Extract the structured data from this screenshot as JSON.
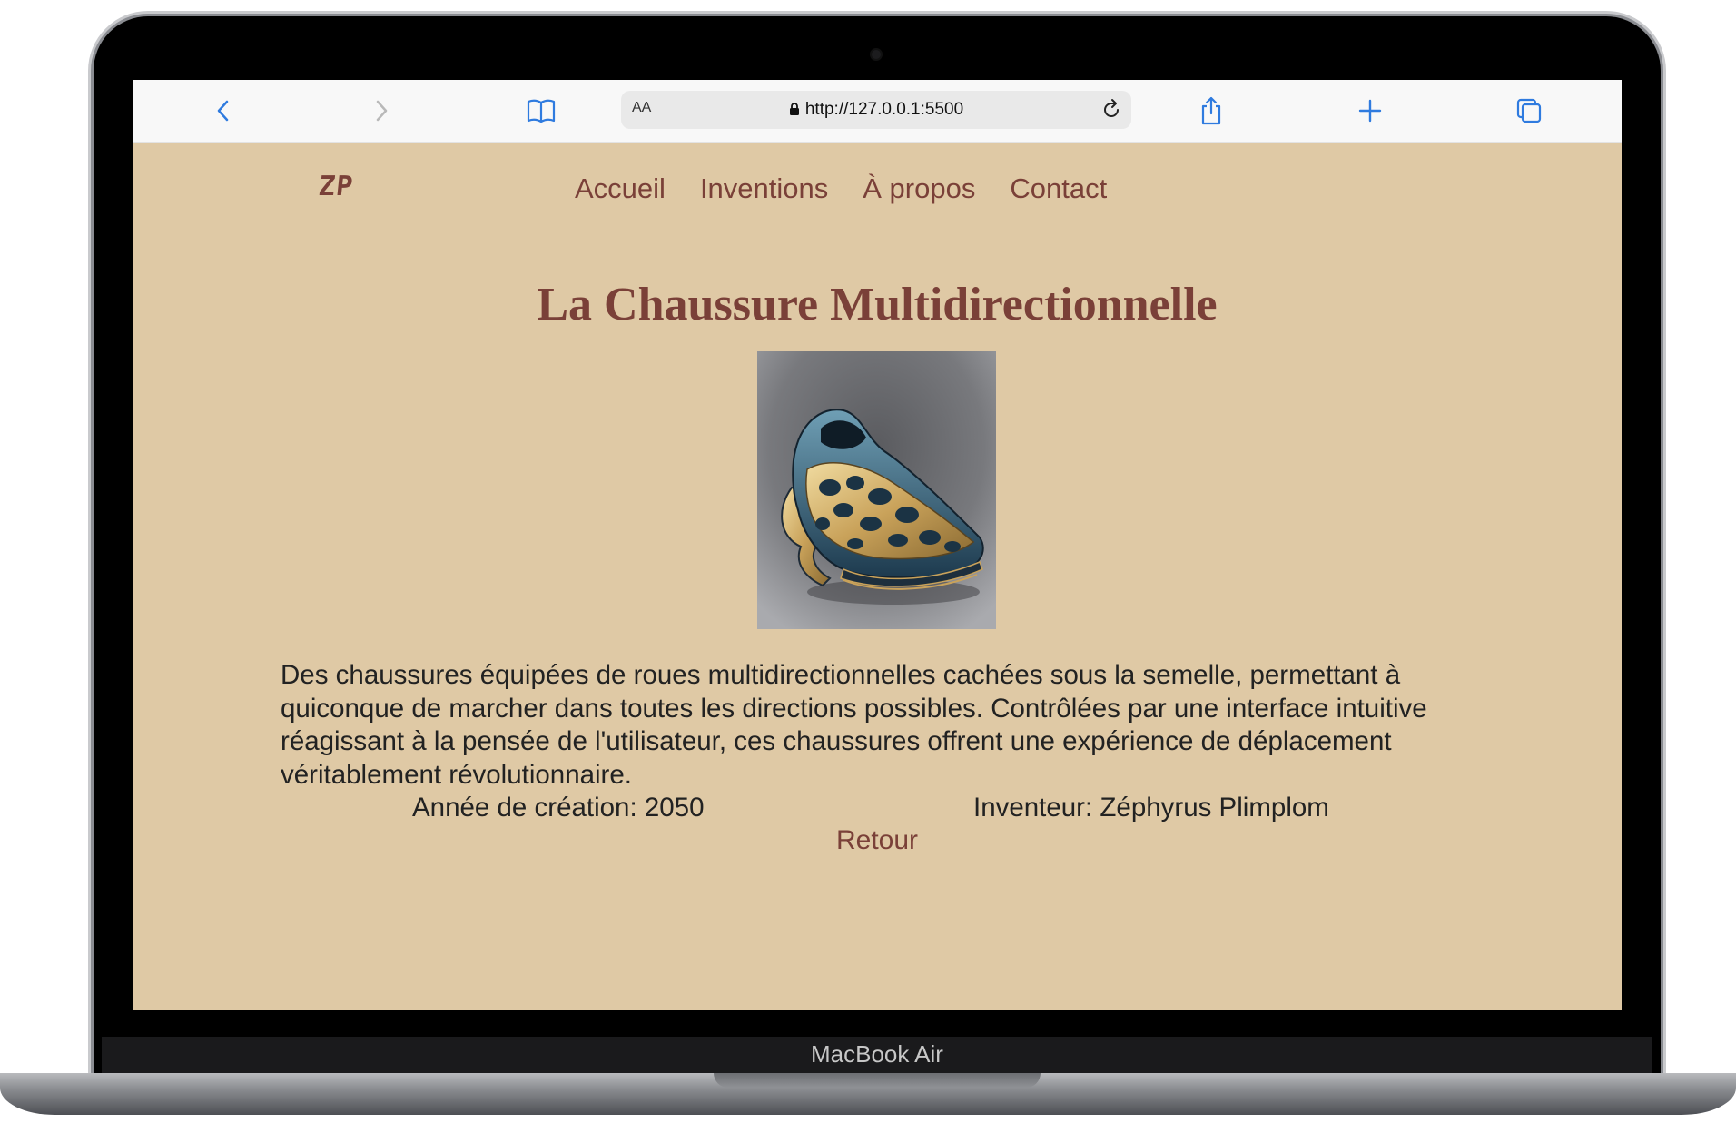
{
  "device": {
    "model_label": "MacBook Air"
  },
  "browser": {
    "text_size_label": "AA",
    "url": "http://127.0.0.1:5500",
    "icons": [
      "back-icon",
      "forward-icon",
      "bookmarks-icon",
      "lock-icon",
      "reload-icon",
      "share-icon",
      "new-tab-icon",
      "tabs-icon"
    ]
  },
  "site": {
    "brand": "ZP",
    "nav": [
      "Accueil",
      "Inventions",
      "À propos",
      "Contact"
    ],
    "accent_color": "#7a4038",
    "background_color": "#dfc9a5"
  },
  "invention": {
    "title": "La Chaussure Multidirectionnelle",
    "image_subject": "futuristic shoe",
    "description": "Des chaussures équipées de roues multidirectionnelles cachées sous la semelle, permettant à quiconque de marcher dans toutes les directions possibles. Contrôlées par une interface intuitive réagissant à la pensée de l'utilisateur, ces chaussures offrent une expérience de déplacement véritablement révolutionnaire.",
    "year": "Année de création: 2050",
    "inventor": "Inventeur: Zéphyrus Plimplom",
    "back_label": "Retour"
  }
}
